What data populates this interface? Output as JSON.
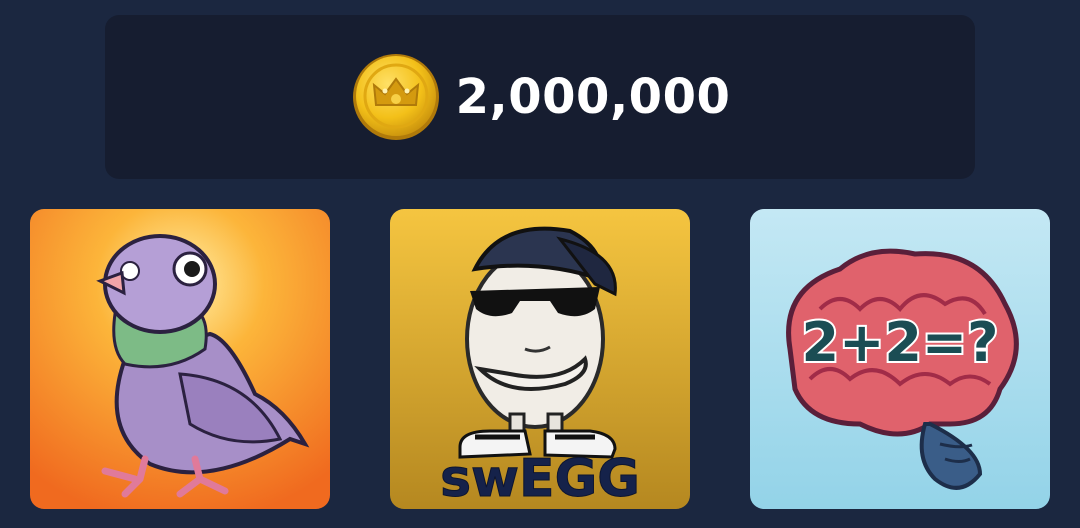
{
  "balance": {
    "amount": "2,000,000",
    "icon": "crown-coin-icon",
    "coin_color": "#f3c019"
  },
  "cards": [
    {
      "name": "pigeon",
      "background": [
        "#fcc53a",
        "#f06a1f"
      ]
    },
    {
      "name": "swegg",
      "caption": "swEGG",
      "background": [
        "#f3c33a",
        "#b7871d"
      ]
    },
    {
      "name": "brain-math",
      "equation": "2+2=?",
      "background": [
        "#bfe6f2",
        "#93d3e8"
      ]
    }
  ]
}
